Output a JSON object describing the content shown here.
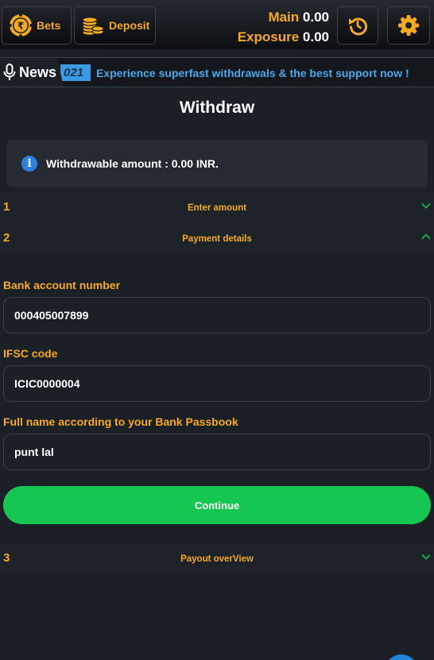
{
  "header": {
    "bets_label": "Bets",
    "deposit_label": "Deposit",
    "main_label": "Main",
    "main_value": "0.00",
    "exposure_label": "Exposure",
    "exposure_value": "0.00"
  },
  "news": {
    "label": "News",
    "year_fragment": "021",
    "ticker": "Experience superfast withdrawals & the best support now !"
  },
  "page": {
    "title": "Withdraw",
    "withdrawable_text": "Withdrawable amount : 0.00 INR."
  },
  "steps": [
    {
      "number": "1",
      "title": "Enter amount",
      "expanded": false
    },
    {
      "number": "2",
      "title": "Payment details",
      "expanded": true
    },
    {
      "number": "3",
      "title": "Payout overView",
      "expanded": false
    }
  ],
  "form": {
    "bank_account_label": "Bank account number",
    "bank_account_value": "000405007899",
    "ifsc_label": "IFSC code",
    "ifsc_value": "ICIC0000004",
    "name_label": "Full name according to your Bank Passbook",
    "name_value": "punt lal",
    "continue_label": "Continue"
  },
  "colors": {
    "accent": "#f5a91f",
    "primary_button": "#16c653",
    "info": "#2d7fe0",
    "ticker_text": "#4aa7e8",
    "background": "#1b1f26"
  },
  "icons": {
    "bets": "rupee-chip-icon",
    "deposit": "coins-stack-icon",
    "refresh": "refresh-icon",
    "settings": "gear-icon",
    "news": "microphone-icon",
    "info": "info-icon"
  }
}
